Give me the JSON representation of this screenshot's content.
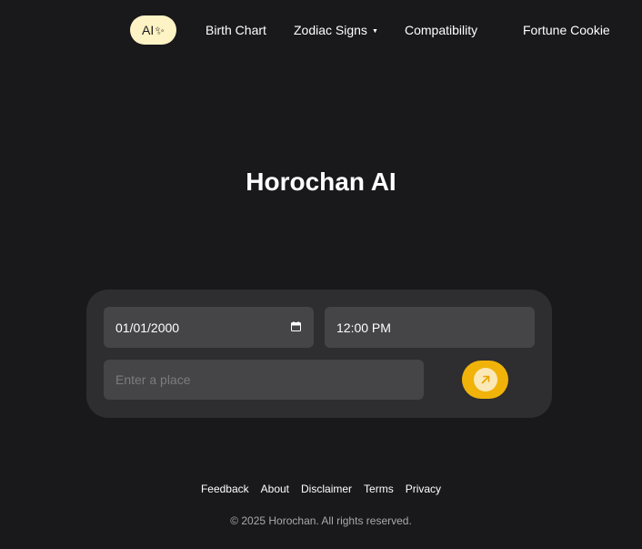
{
  "nav": {
    "ai_label": "AI",
    "sparkle_icon": "sparkle-icon",
    "links": [
      "Birth Chart",
      "Zodiac Signs",
      "Compatibility",
      "Fortune Cookie"
    ],
    "dropdown_icon": "caret-down-icon"
  },
  "hero": {
    "title": "Horochan AI"
  },
  "form": {
    "date_value": "01/01/2000",
    "time_value": "12:00 PM",
    "place_placeholder": "Enter a place",
    "calendar_icon": "calendar-icon",
    "submit_icon": "arrow-up-right-icon"
  },
  "footer": {
    "links": [
      "Feedback",
      "About",
      "Disclaimer",
      "Terms",
      "Privacy"
    ],
    "copyright": "© 2025 Horochan. All rights reserved."
  },
  "colors": {
    "background": "#19181b",
    "card": "#2e2d30",
    "field": "#454446",
    "accent": "#f1b30a",
    "ai_pill": "#fdf3c4"
  }
}
